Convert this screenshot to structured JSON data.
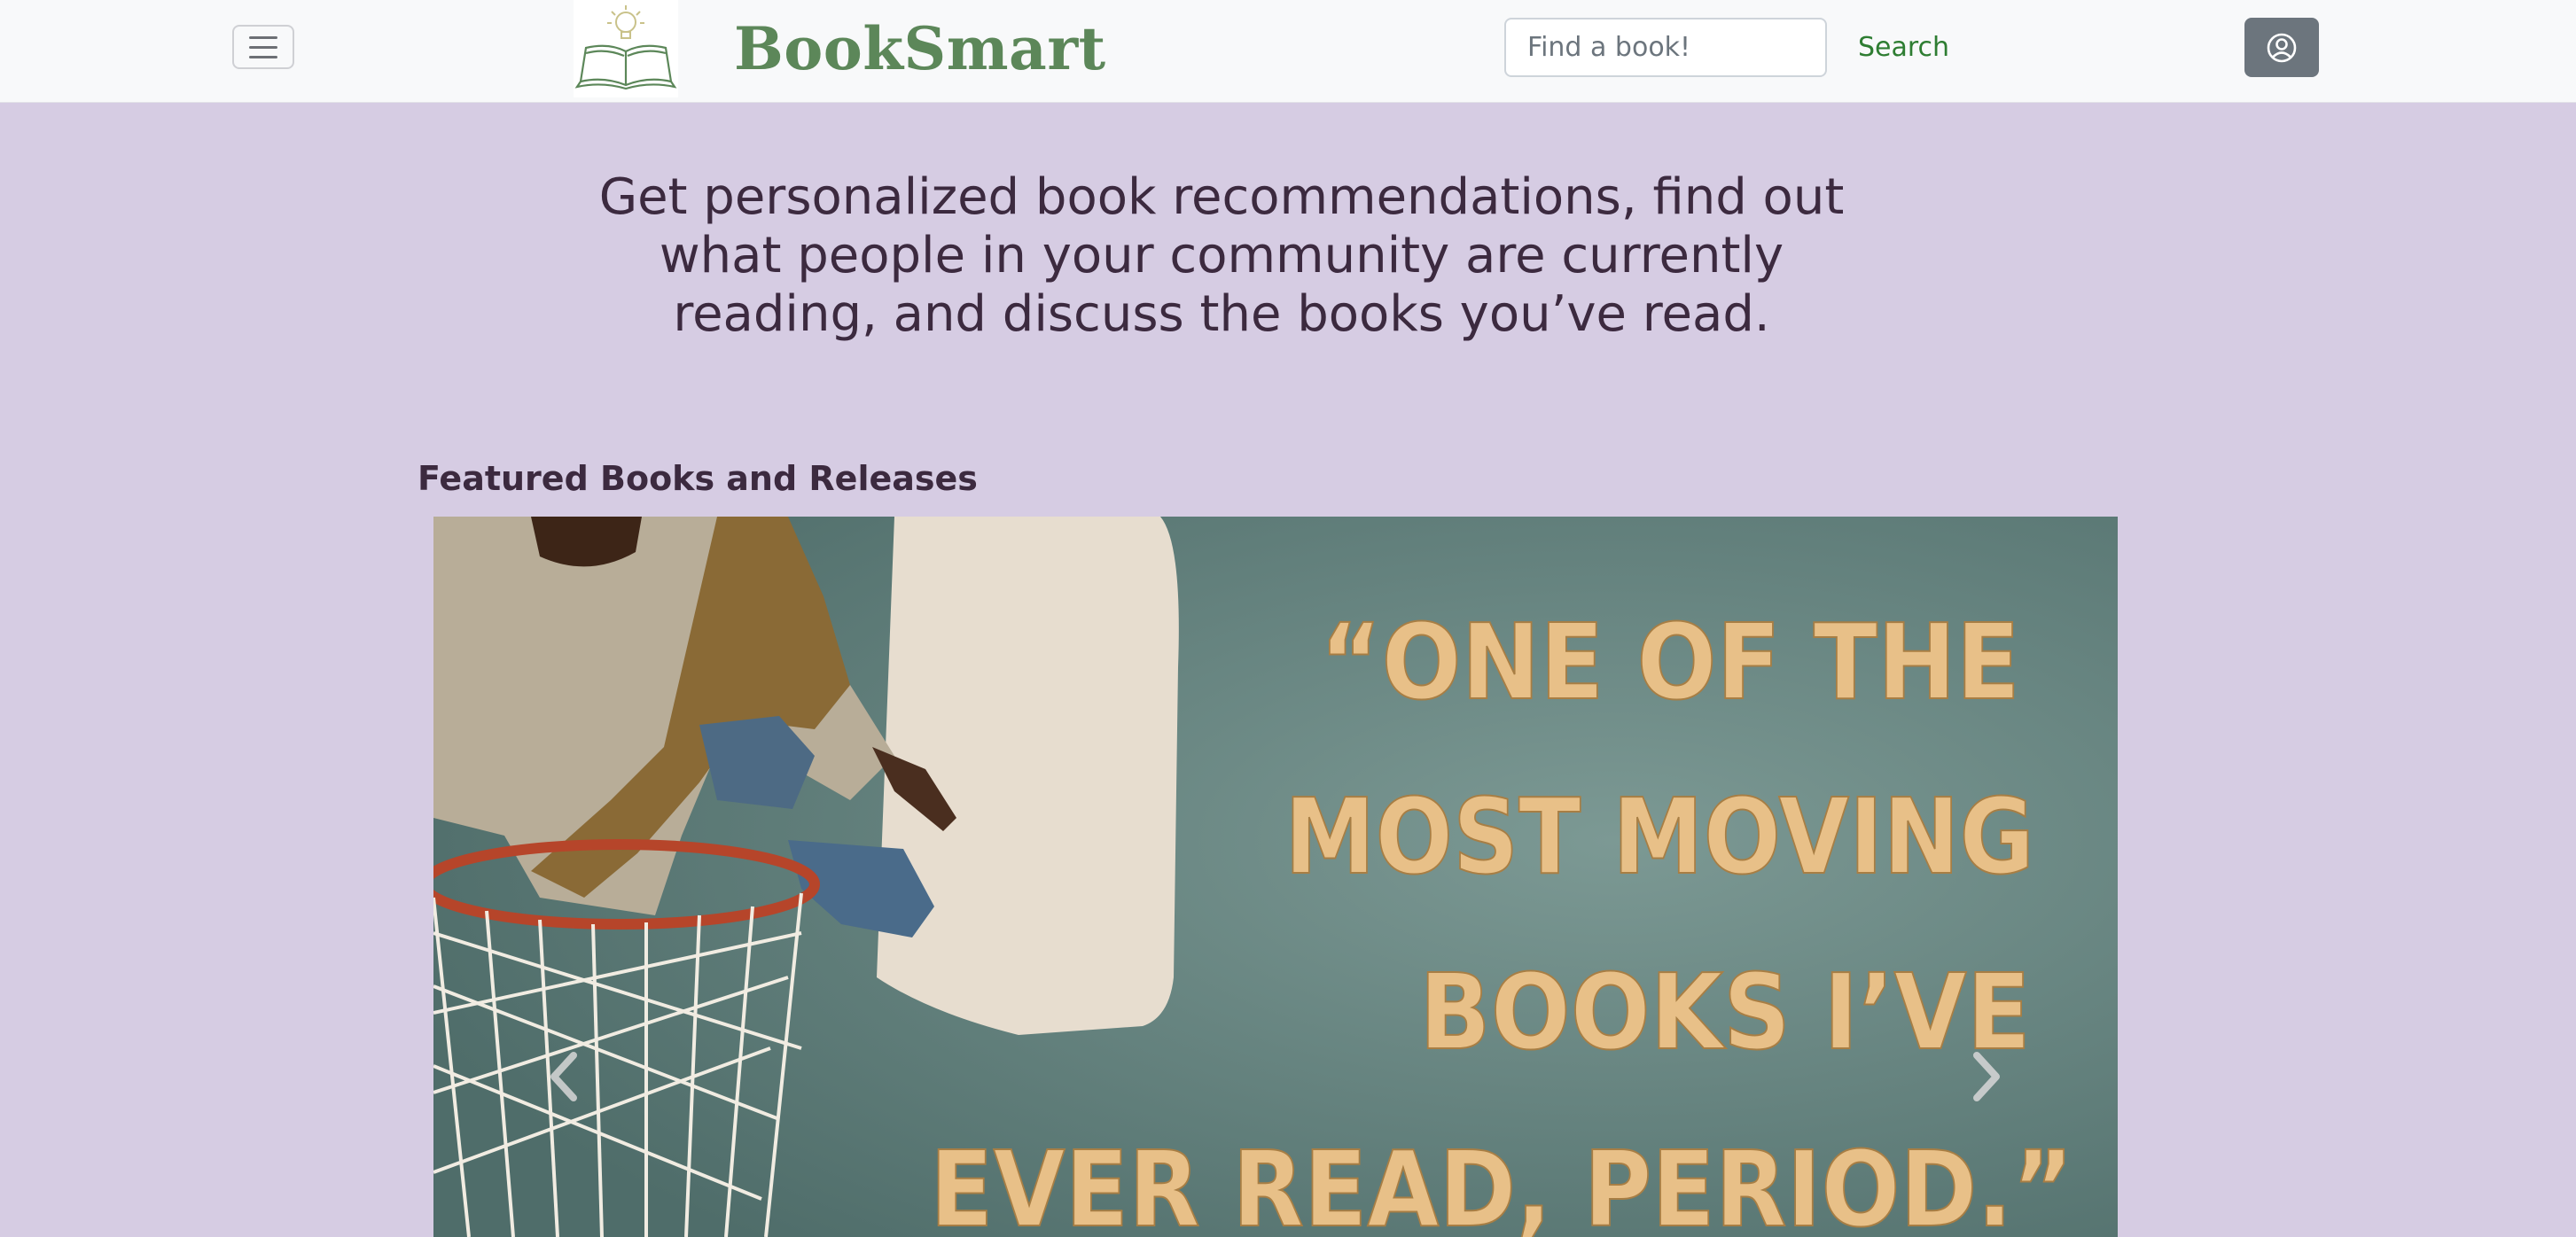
{
  "navbar": {
    "brand": "BookSmart",
    "menu_icon": "hamburger-menu-icon",
    "logo_icon": "open-book-lightbulb-logo",
    "search": {
      "placeholder": "Find a book!",
      "value": ""
    },
    "search_button_label": "Search",
    "account_icon": "user-circle-icon"
  },
  "hero": {
    "tagline": "Get personalized book recommendations, find out what people in your community are currently reading, and discuss the books you’ve read."
  },
  "featured": {
    "heading": "Featured Books and Releases",
    "slides": [
      {
        "quote_lines": [
          "“ONE OF THE",
          "MOST MOVING",
          "BOOKS I’VE",
          "EVER READ, PERIOD.”"
        ]
      }
    ],
    "prev_icon": "chevron-left-icon",
    "next_icon": "chevron-right-icon"
  },
  "colors": {
    "page_bg": "#d6cce3",
    "navbar_bg": "#f8f9fa",
    "brand": "#5c8759",
    "text": "#3c2a3f",
    "search_button": "#2e7d32",
    "account_button": "#6c757d",
    "quote_text": "#e8c088"
  }
}
